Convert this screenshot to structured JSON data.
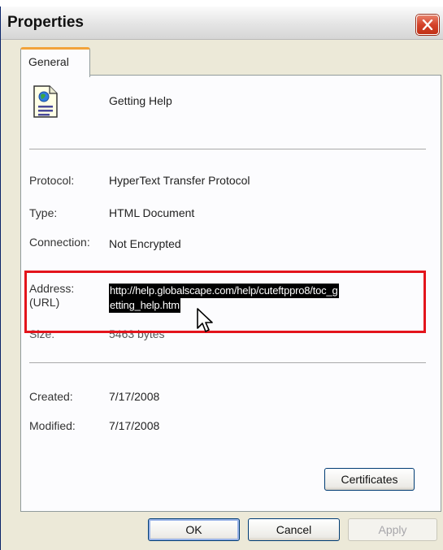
{
  "window": {
    "title": "Properties",
    "close_label": ""
  },
  "tabs": [
    {
      "label": "General",
      "active": true
    }
  ],
  "general": {
    "icon": "html-document-globe-icon",
    "name": "Getting Help",
    "protocol_label": "Protocol:",
    "protocol_value": "HyperText Transfer Protocol",
    "type_label": "Type:",
    "type_value": "HTML Document",
    "connection_label": "Connection:",
    "connection_value": "Not Encrypted",
    "address_label_1": "Address:",
    "address_label_2": "(URL)",
    "address_value_1": "http://help.globalscape.com/help/cuteftppro8/toc_g",
    "address_value_2": "etting_help.htm",
    "size_label": "Size:",
    "size_value": "5463 bytes",
    "created_label": "Created:",
    "created_value": "7/17/2008",
    "modified_label": "Modified:",
    "modified_value": "7/17/2008",
    "certificates_label": "Certificates"
  },
  "buttons": {
    "ok": "OK",
    "cancel": "Cancel",
    "apply": "Apply"
  },
  "colors": {
    "highlight_box": "#e3141c",
    "tab_accent": "#f2a33b",
    "dialog_bg": "#ece9d8"
  }
}
